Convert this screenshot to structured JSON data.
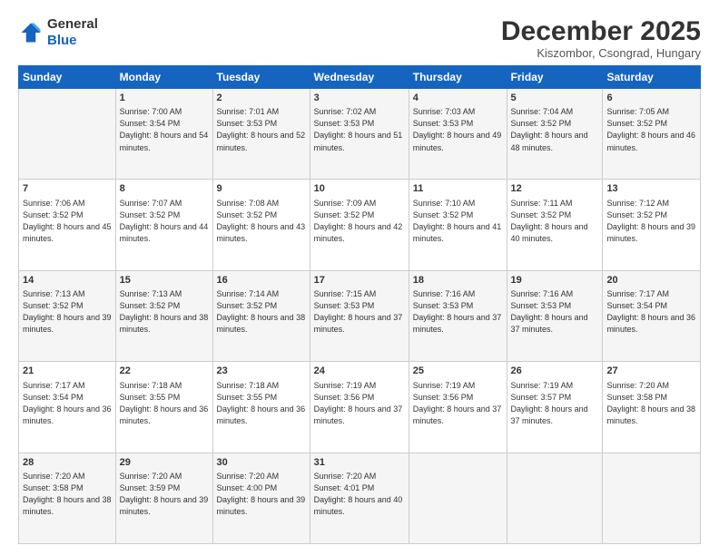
{
  "logo": {
    "line1": "General",
    "line2": "Blue"
  },
  "title": "December 2025",
  "subtitle": "Kiszombor, Csongrad, Hungary",
  "days_of_week": [
    "Sunday",
    "Monday",
    "Tuesday",
    "Wednesday",
    "Thursday",
    "Friday",
    "Saturday"
  ],
  "weeks": [
    [
      {
        "day": "",
        "sunrise": "",
        "sunset": "",
        "daylight": ""
      },
      {
        "day": "1",
        "sunrise": "Sunrise: 7:00 AM",
        "sunset": "Sunset: 3:54 PM",
        "daylight": "Daylight: 8 hours and 54 minutes."
      },
      {
        "day": "2",
        "sunrise": "Sunrise: 7:01 AM",
        "sunset": "Sunset: 3:53 PM",
        "daylight": "Daylight: 8 hours and 52 minutes."
      },
      {
        "day": "3",
        "sunrise": "Sunrise: 7:02 AM",
        "sunset": "Sunset: 3:53 PM",
        "daylight": "Daylight: 8 hours and 51 minutes."
      },
      {
        "day": "4",
        "sunrise": "Sunrise: 7:03 AM",
        "sunset": "Sunset: 3:53 PM",
        "daylight": "Daylight: 8 hours and 49 minutes."
      },
      {
        "day": "5",
        "sunrise": "Sunrise: 7:04 AM",
        "sunset": "Sunset: 3:52 PM",
        "daylight": "Daylight: 8 hours and 48 minutes."
      },
      {
        "day": "6",
        "sunrise": "Sunrise: 7:05 AM",
        "sunset": "Sunset: 3:52 PM",
        "daylight": "Daylight: 8 hours and 46 minutes."
      }
    ],
    [
      {
        "day": "7",
        "sunrise": "Sunrise: 7:06 AM",
        "sunset": "Sunset: 3:52 PM",
        "daylight": "Daylight: 8 hours and 45 minutes."
      },
      {
        "day": "8",
        "sunrise": "Sunrise: 7:07 AM",
        "sunset": "Sunset: 3:52 PM",
        "daylight": "Daylight: 8 hours and 44 minutes."
      },
      {
        "day": "9",
        "sunrise": "Sunrise: 7:08 AM",
        "sunset": "Sunset: 3:52 PM",
        "daylight": "Daylight: 8 hours and 43 minutes."
      },
      {
        "day": "10",
        "sunrise": "Sunrise: 7:09 AM",
        "sunset": "Sunset: 3:52 PM",
        "daylight": "Daylight: 8 hours and 42 minutes."
      },
      {
        "day": "11",
        "sunrise": "Sunrise: 7:10 AM",
        "sunset": "Sunset: 3:52 PM",
        "daylight": "Daylight: 8 hours and 41 minutes."
      },
      {
        "day": "12",
        "sunrise": "Sunrise: 7:11 AM",
        "sunset": "Sunset: 3:52 PM",
        "daylight": "Daylight: 8 hours and 40 minutes."
      },
      {
        "day": "13",
        "sunrise": "Sunrise: 7:12 AM",
        "sunset": "Sunset: 3:52 PM",
        "daylight": "Daylight: 8 hours and 39 minutes."
      }
    ],
    [
      {
        "day": "14",
        "sunrise": "Sunrise: 7:13 AM",
        "sunset": "Sunset: 3:52 PM",
        "daylight": "Daylight: 8 hours and 39 minutes."
      },
      {
        "day": "15",
        "sunrise": "Sunrise: 7:13 AM",
        "sunset": "Sunset: 3:52 PM",
        "daylight": "Daylight: 8 hours and 38 minutes."
      },
      {
        "day": "16",
        "sunrise": "Sunrise: 7:14 AM",
        "sunset": "Sunset: 3:52 PM",
        "daylight": "Daylight: 8 hours and 38 minutes."
      },
      {
        "day": "17",
        "sunrise": "Sunrise: 7:15 AM",
        "sunset": "Sunset: 3:53 PM",
        "daylight": "Daylight: 8 hours and 37 minutes."
      },
      {
        "day": "18",
        "sunrise": "Sunrise: 7:16 AM",
        "sunset": "Sunset: 3:53 PM",
        "daylight": "Daylight: 8 hours and 37 minutes."
      },
      {
        "day": "19",
        "sunrise": "Sunrise: 7:16 AM",
        "sunset": "Sunset: 3:53 PM",
        "daylight": "Daylight: 8 hours and 37 minutes."
      },
      {
        "day": "20",
        "sunrise": "Sunrise: 7:17 AM",
        "sunset": "Sunset: 3:54 PM",
        "daylight": "Daylight: 8 hours and 36 minutes."
      }
    ],
    [
      {
        "day": "21",
        "sunrise": "Sunrise: 7:17 AM",
        "sunset": "Sunset: 3:54 PM",
        "daylight": "Daylight: 8 hours and 36 minutes."
      },
      {
        "day": "22",
        "sunrise": "Sunrise: 7:18 AM",
        "sunset": "Sunset: 3:55 PM",
        "daylight": "Daylight: 8 hours and 36 minutes."
      },
      {
        "day": "23",
        "sunrise": "Sunrise: 7:18 AM",
        "sunset": "Sunset: 3:55 PM",
        "daylight": "Daylight: 8 hours and 36 minutes."
      },
      {
        "day": "24",
        "sunrise": "Sunrise: 7:19 AM",
        "sunset": "Sunset: 3:56 PM",
        "daylight": "Daylight: 8 hours and 37 minutes."
      },
      {
        "day": "25",
        "sunrise": "Sunrise: 7:19 AM",
        "sunset": "Sunset: 3:56 PM",
        "daylight": "Daylight: 8 hours and 37 minutes."
      },
      {
        "day": "26",
        "sunrise": "Sunrise: 7:19 AM",
        "sunset": "Sunset: 3:57 PM",
        "daylight": "Daylight: 8 hours and 37 minutes."
      },
      {
        "day": "27",
        "sunrise": "Sunrise: 7:20 AM",
        "sunset": "Sunset: 3:58 PM",
        "daylight": "Daylight: 8 hours and 38 minutes."
      }
    ],
    [
      {
        "day": "28",
        "sunrise": "Sunrise: 7:20 AM",
        "sunset": "Sunset: 3:58 PM",
        "daylight": "Daylight: 8 hours and 38 minutes."
      },
      {
        "day": "29",
        "sunrise": "Sunrise: 7:20 AM",
        "sunset": "Sunset: 3:59 PM",
        "daylight": "Daylight: 8 hours and 39 minutes."
      },
      {
        "day": "30",
        "sunrise": "Sunrise: 7:20 AM",
        "sunset": "Sunset: 4:00 PM",
        "daylight": "Daylight: 8 hours and 39 minutes."
      },
      {
        "day": "31",
        "sunrise": "Sunrise: 7:20 AM",
        "sunset": "Sunset: 4:01 PM",
        "daylight": "Daylight: 8 hours and 40 minutes."
      },
      {
        "day": "",
        "sunrise": "",
        "sunset": "",
        "daylight": ""
      },
      {
        "day": "",
        "sunrise": "",
        "sunset": "",
        "daylight": ""
      },
      {
        "day": "",
        "sunrise": "",
        "sunset": "",
        "daylight": ""
      }
    ]
  ]
}
